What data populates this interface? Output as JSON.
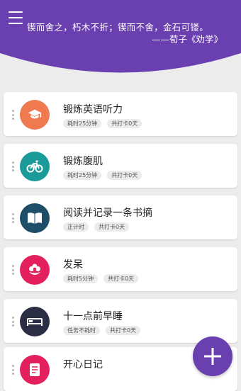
{
  "header": {
    "quote": "锲而舍之，朽木不折；锲而不舍，金石可镂。",
    "author": "——荀子《劝学》",
    "bg_color": "#6a3fb0"
  },
  "tasks": [
    {
      "title": "锻炼英语听力",
      "duration": "耗时25分钟",
      "checkins": "共打卡0天",
      "color": "#f07a4f",
      "icon": "graduation-cap-icon"
    },
    {
      "title": "锻炼腹肌",
      "duration": "耗时25分钟",
      "checkins": "共打卡0天",
      "color": "#1b9a9a",
      "icon": "bicycle-icon"
    },
    {
      "title": "阅读并记录一条书摘",
      "duration": "正计时",
      "checkins": "共打卡0天",
      "color": "#1f4e68",
      "icon": "book-icon"
    },
    {
      "title": "发呆",
      "duration": "耗时5分钟",
      "checkins": "共打卡0天",
      "color": "#e31f5d",
      "icon": "flower-icon"
    },
    {
      "title": "十一点前早睡",
      "duration": "任务不耗时",
      "checkins": "共打卡0天",
      "color": "#2b2d44",
      "icon": "bed-icon"
    },
    {
      "title": "开心日记",
      "color": "#e31f5d",
      "icon": "diary-icon"
    }
  ],
  "fab": {
    "icon": "add-icon",
    "color": "#6a3fb0"
  }
}
